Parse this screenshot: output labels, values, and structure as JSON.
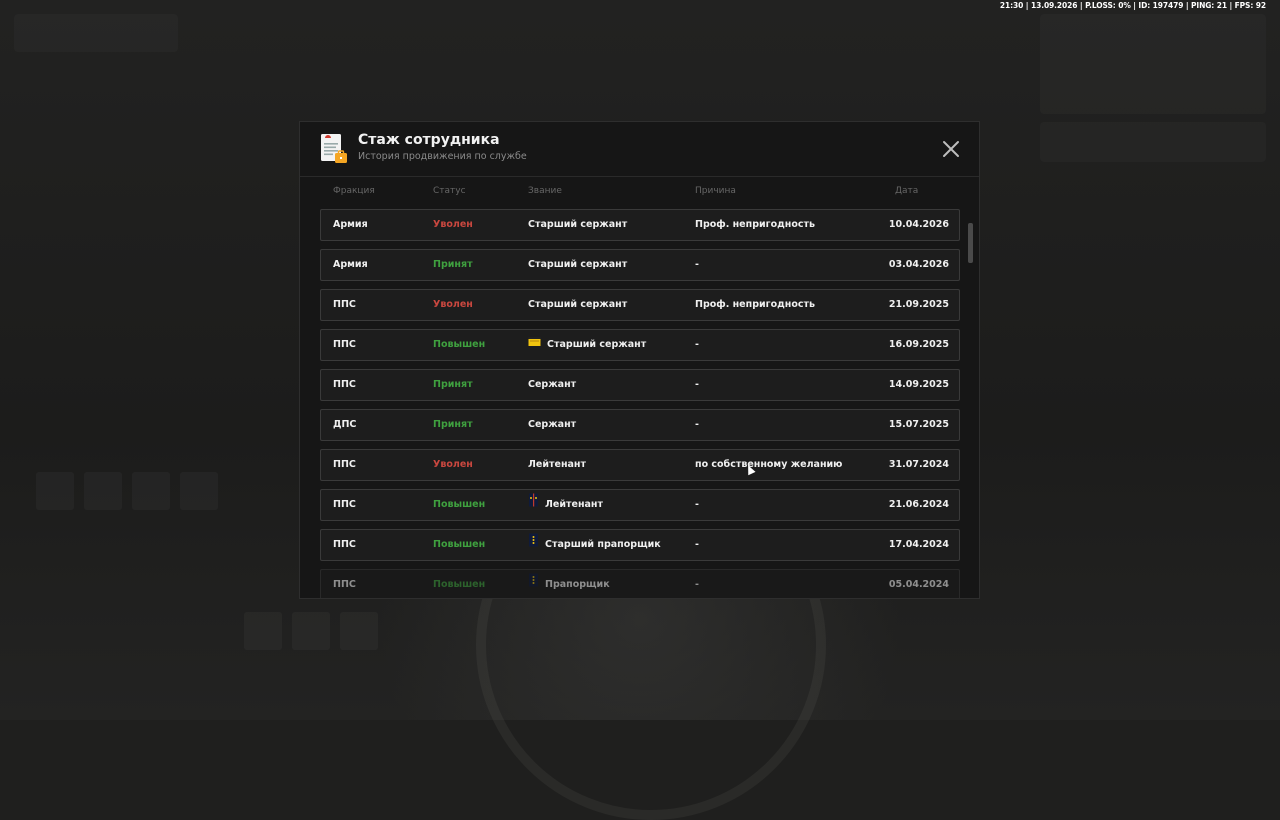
{
  "hud": {
    "text": "21:30 | 13.09.2026 | P.LOSS: 0% | ID: 197479 | PING: 21 | FPS: 92"
  },
  "dialog": {
    "title": "Стаж сотрудника",
    "subtitle": "История продвижения по службе",
    "icon": "document-briefcase-icon",
    "close_icon": "close-icon"
  },
  "columns": {
    "faction": "Фракция",
    "status": "Статус",
    "rank": "Звание",
    "reason": "Причина",
    "date": "Дата"
  },
  "colors": {
    "status_fired": "#c9473f",
    "status_positive": "#3fa13f",
    "accent": "#f5a623"
  },
  "rows": [
    {
      "faction": "Армия",
      "status": "Уволен",
      "status_type": "fired",
      "rank": "Старший сержант",
      "badge": "",
      "reason": "Проф. непригодность",
      "date": "10.04.2026"
    },
    {
      "faction": "Армия",
      "status": "Принят",
      "status_type": "positive",
      "rank": "Старший сержант",
      "badge": "",
      "reason": "-",
      "date": "03.04.2026"
    },
    {
      "faction": "ППС",
      "status": "Уволен",
      "status_type": "fired",
      "rank": "Старший сержант",
      "badge": "",
      "reason": "Проф. непригодность",
      "date": "21.09.2025"
    },
    {
      "faction": "ППС",
      "status": "Повышен",
      "status_type": "positive",
      "rank": "Старший сержант",
      "badge": "sergeant-badge-icon",
      "reason": "-",
      "date": "16.09.2025"
    },
    {
      "faction": "ППС",
      "status": "Принят",
      "status_type": "positive",
      "rank": "Сержант",
      "badge": "",
      "reason": "-",
      "date": "14.09.2025"
    },
    {
      "faction": "ДПС",
      "status": "Принят",
      "status_type": "positive",
      "rank": "Сержант",
      "badge": "",
      "reason": "-",
      "date": "15.07.2025"
    },
    {
      "faction": "ППС",
      "status": "Уволен",
      "status_type": "fired",
      "rank": "Лейтенант",
      "badge": "",
      "reason": "по собственному желанию",
      "date": "31.07.2024"
    },
    {
      "faction": "ППС",
      "status": "Повышен",
      "status_type": "positive",
      "rank": "Лейтенант",
      "badge": "lieutenant-badge-icon",
      "reason": "-",
      "date": "21.06.2024"
    },
    {
      "faction": "ППС",
      "status": "Повышен",
      "status_type": "positive",
      "rank": "Старший прапорщик",
      "badge": "warrant-officer-badge-icon",
      "reason": "-",
      "date": "17.04.2024"
    },
    {
      "faction": "ППС",
      "status": "Повышен",
      "status_type": "positive",
      "rank": "Прапорщик",
      "badge": "warrant-officer-badge-icon",
      "reason": "-",
      "date": "05.04.2024"
    }
  ]
}
